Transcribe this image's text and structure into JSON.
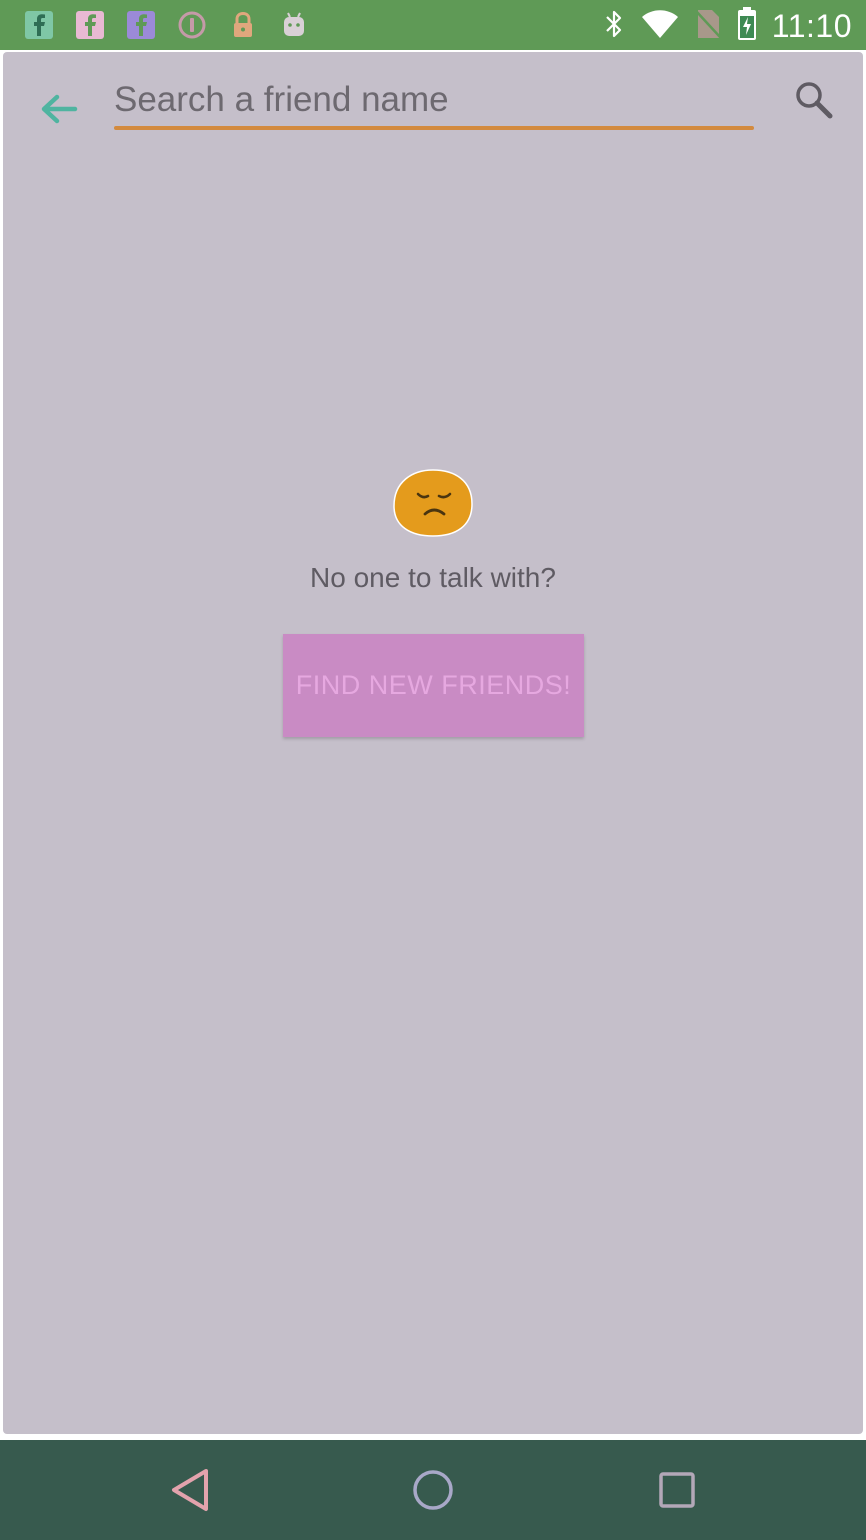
{
  "status_bar": {
    "time": "11:10",
    "notification_icons": [
      "facebook-icon",
      "facebook-icon",
      "facebook-icon",
      "1password-icon",
      "lock-icon",
      "android-icon"
    ],
    "system_icons": [
      "bluetooth-icon",
      "wifi-icon",
      "no-sim-icon",
      "battery-charging-icon"
    ],
    "color": "#5f9a56"
  },
  "toolbar": {
    "search": {
      "value": "",
      "placeholder": "Search a friend name"
    },
    "accent_color": "#d38a3e"
  },
  "empty_state": {
    "emoji": "pensive-face-emoji",
    "message": "No one to talk with?",
    "button_label": "FIND NEW FRIENDS!"
  },
  "nav_bar": {
    "buttons": [
      "back-icon",
      "home-icon",
      "recents-icon"
    ],
    "color": "#375a4e"
  }
}
